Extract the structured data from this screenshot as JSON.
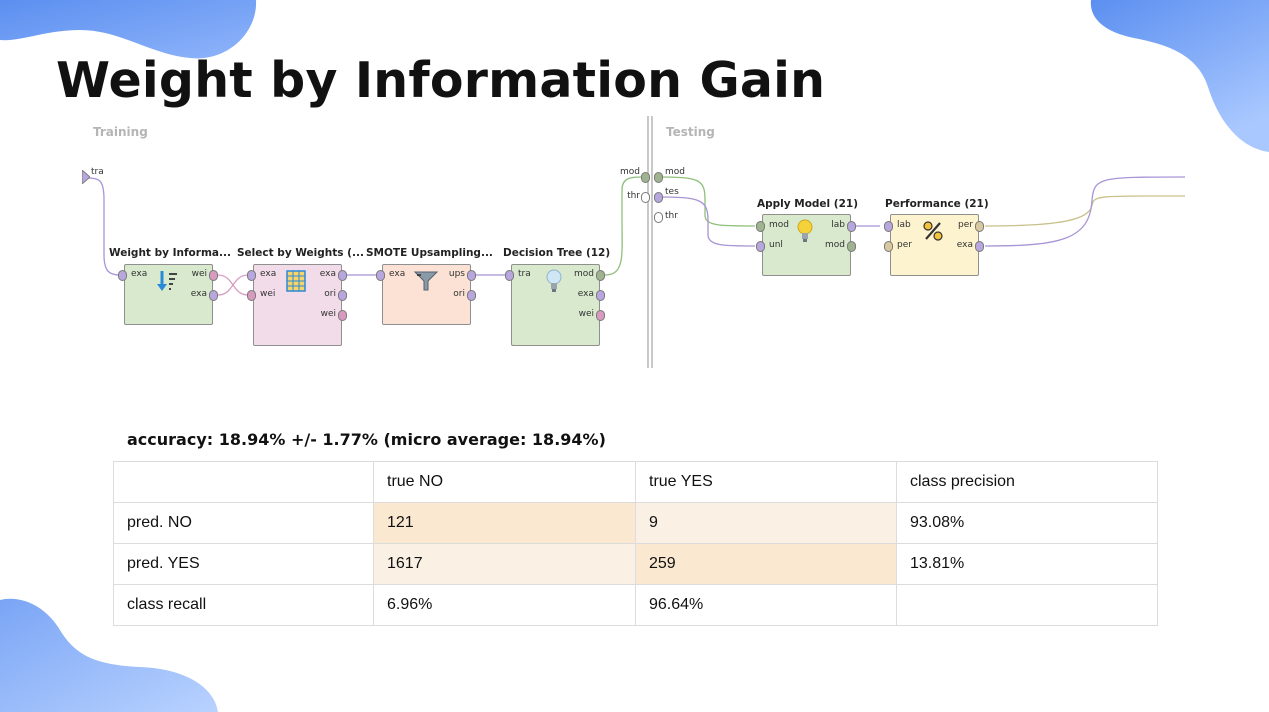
{
  "slide": {
    "title": "Weight by Information Gain"
  },
  "process": {
    "sections": {
      "training": "Training",
      "testing": "Testing"
    },
    "left_ports": {
      "input": "tra",
      "mod_out": "mod",
      "thr_out": "thr"
    },
    "right_ports": {
      "mod": "mod",
      "tes": "tes",
      "thr": "thr"
    },
    "operators": [
      {
        "title": "Weight by Informa...",
        "in": [
          "exa"
        ],
        "out": [
          "wei",
          "exa"
        ],
        "icon": "sort-weights-icon",
        "color": "#d8e9ce"
      },
      {
        "title": "Select by Weights (...",
        "in": [
          "exa",
          "wei"
        ],
        "out": [
          "exa",
          "ori",
          "wei"
        ],
        "icon": "table-grid-icon",
        "color": "#f2dcea"
      },
      {
        "title": "SMOTE Upsampling...",
        "in": [
          "exa"
        ],
        "out": [
          "ups",
          "ori"
        ],
        "icon": "funnel-icon",
        "color": "#fbe2d4"
      },
      {
        "title": "Decision Tree (12)",
        "in": [
          "tra"
        ],
        "out": [
          "mod",
          "exa",
          "wei"
        ],
        "icon": "lightbulb-icon",
        "color": "#d8e9ce"
      },
      {
        "title": "Apply Model (21)",
        "in": [
          "mod",
          "unl"
        ],
        "out": [
          "lab",
          "mod"
        ],
        "icon": "lightbulb-yellow-icon",
        "color": "#d8e9ce"
      },
      {
        "title": "Performance (21)",
        "in": [
          "lab",
          "per"
        ],
        "out": [
          "per",
          "exa"
        ],
        "icon": "percent-icon",
        "color": "#fdf3cf"
      }
    ]
  },
  "results": {
    "accuracy": "accuracy: 18.94% +/- 1.77% (micro average: 18.94%)",
    "headers": [
      "",
      "true NO",
      "true YES",
      "class precision"
    ],
    "rows": [
      [
        "pred. NO",
        "121",
        "9",
        "93.08%"
      ],
      [
        "pred. YES",
        "1617",
        "259",
        "13.81%"
      ],
      [
        "class recall",
        "6.96%",
        "96.64%",
        ""
      ]
    ]
  },
  "colors": {
    "blob_blue": "#5b8ff0",
    "blob_light": "#a9c8ff",
    "cell_highlight": "#fae8d0",
    "cell_light": "#faf1e4"
  }
}
